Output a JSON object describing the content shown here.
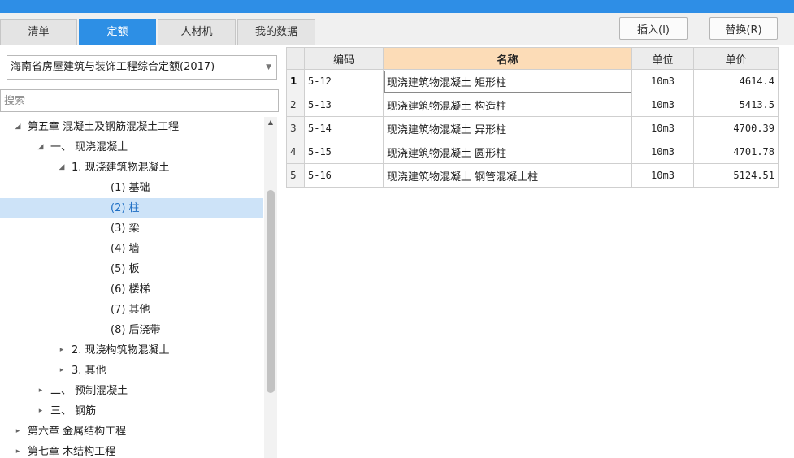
{
  "colors": {
    "accent": "#2d8fe5",
    "header_highlight": "#fcdcb7",
    "selection": "#cde3f8"
  },
  "tabs": [
    {
      "label": "清单",
      "active": false
    },
    {
      "label": "定额",
      "active": true
    },
    {
      "label": "人材机",
      "active": false
    },
    {
      "label": "我的数据",
      "active": false
    }
  ],
  "toolbar": {
    "insert_label": "插入(I)",
    "replace_label": "替换(R)"
  },
  "library": {
    "selected": "海南省房屋建筑与装饰工程综合定额(2017)",
    "arrow_icon": "chevron-down-icon"
  },
  "search": {
    "placeholder": "搜索",
    "value": ""
  },
  "tree": [
    {
      "label": "第五章 混凝土及钢筋混凝土工程",
      "level": 1,
      "expander": "expanded"
    },
    {
      "label": "一、 现浇混凝土",
      "level": 2,
      "expander": "expanded"
    },
    {
      "label": "1. 现浇建筑物混凝土",
      "level": 3,
      "expander": "expanded"
    },
    {
      "label": "(1) 基础",
      "level": 4,
      "expander": "none"
    },
    {
      "label": "(2) 柱",
      "level": 4,
      "expander": "none",
      "selected": true
    },
    {
      "label": "(3) 梁",
      "level": 4,
      "expander": "none"
    },
    {
      "label": "(4) 墙",
      "level": 4,
      "expander": "none"
    },
    {
      "label": "(5) 板",
      "level": 4,
      "expander": "none"
    },
    {
      "label": "(6) 楼梯",
      "level": 4,
      "expander": "none"
    },
    {
      "label": "(7) 其他",
      "level": 4,
      "expander": "none"
    },
    {
      "label": "(8) 后浇带",
      "level": 4,
      "expander": "none"
    },
    {
      "label": "2. 现浇构筑物混凝土",
      "level": 3,
      "expander": "collapsed"
    },
    {
      "label": "3. 其他",
      "level": 3,
      "expander": "collapsed"
    },
    {
      "label": "二、 预制混凝土",
      "level": 2,
      "expander": "collapsed"
    },
    {
      "label": "三、 钢筋",
      "level": 2,
      "expander": "collapsed"
    },
    {
      "label": "第六章 金属结构工程",
      "level": 1,
      "expander": "collapsed"
    },
    {
      "label": "第七章 木结构工程",
      "level": 1,
      "expander": "collapsed"
    }
  ],
  "grid": {
    "columns": [
      "",
      "编码",
      "名称",
      "单位",
      "单价"
    ],
    "rows": [
      {
        "num": "1",
        "code": "5-12",
        "name": "现浇建筑物混凝土 矩形柱",
        "unit": "10m3",
        "price": "4614.4"
      },
      {
        "num": "2",
        "code": "5-13",
        "name": "现浇建筑物混凝土 构造柱",
        "unit": "10m3",
        "price": "5413.5"
      },
      {
        "num": "3",
        "code": "5-14",
        "name": "现浇建筑物混凝土 异形柱",
        "unit": "10m3",
        "price": "4700.39"
      },
      {
        "num": "4",
        "code": "5-15",
        "name": "现浇建筑物混凝土 圆形柱",
        "unit": "10m3",
        "price": "4701.78"
      },
      {
        "num": "5",
        "code": "5-16",
        "name": "现浇建筑物混凝土 钢管混凝土柱",
        "unit": "10m3",
        "price": "5124.51"
      }
    ],
    "current_row": 0
  }
}
